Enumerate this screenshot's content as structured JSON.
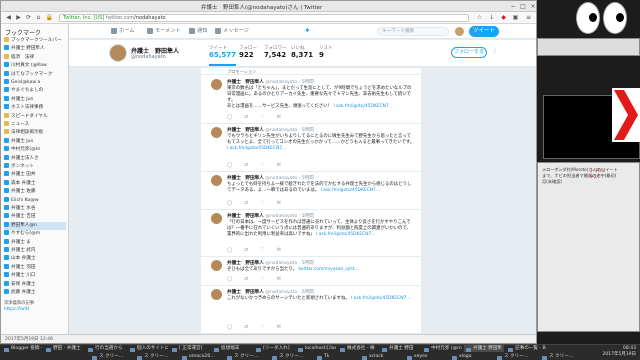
{
  "browser": {
    "window_title": "弁護士　野田隼人(@nodahayato)さん | Twitter",
    "url_host": "twitter.com",
    "url_path": "/nodahayato",
    "url_prefix": "Twitter, Inc. [US]"
  },
  "sidebar": {
    "header": "ブックマーク",
    "items": [
      {
        "label": "ブックマークツールバー",
        "folder": true
      },
      {
        "label": "弁護士 野田隼人",
        "folder": false
      },
      {
        "label": "経済　法律",
        "folder": true
      },
      {
        "label": "川村真文 (@Kaw",
        "folder": false
      },
      {
        "label": "はてなブックマーク",
        "folder": false
      },
      {
        "label": "Geisl@kaw a",
        "folder": false
      },
      {
        "label": "やまぐちよしの",
        "folder": false
      },
      {
        "label": "弁護士 Jun",
        "folder": false
      },
      {
        "label": "ホスト法律事務",
        "folder": false
      },
      {
        "label": "スピードダイヤル",
        "folder": true
      },
      {
        "label": "ニュース",
        "folder": true
      },
      {
        "label": "法律相談掲示板",
        "folder": true
      },
      {
        "label": "弁護士 Jun",
        "folder": false
      },
      {
        "label": "中村元弥(@m",
        "folder": false
      },
      {
        "label": "弁護士法人さ",
        "folder": false
      },
      {
        "label": "ボンネット",
        "folder": false
      },
      {
        "label": "弁護士 田井",
        "folder": false
      },
      {
        "label": "森本 弁護士",
        "folder": false
      },
      {
        "label": "弁護士 佐藤",
        "folder": false
      },
      {
        "label": "Eiichi Ko@w",
        "folder": false
      },
      {
        "label": "弁護士 水谷",
        "folder": false
      },
      {
        "label": "弁護士 吉田",
        "folder": false
      },
      {
        "label": "野田隼人@n",
        "folder": false
      },
      {
        "label": "やすむら(@m",
        "folder": false
      },
      {
        "label": "弁護士 ま",
        "folder": false
      },
      {
        "label": "弁護士 武内",
        "folder": false
      },
      {
        "label": "山本 弁護士",
        "folder": false
      },
      {
        "label": "弁護士 羽田",
        "folder": false
      },
      {
        "label": "弁護士 川口",
        "folder": false
      },
      {
        "label": "安保 弁護士",
        "folder": false
      },
      {
        "label": "武藤 弁護士",
        "folder": false
      }
    ],
    "notice": "深津義和の記事",
    "notice2": "https://twitt"
  },
  "twitter": {
    "nav": {
      "home": "ホーム",
      "moments": "モーメント",
      "notifications": "通知",
      "messages": "メッセージ"
    },
    "search_placeholder": "キーワード検索",
    "tweet_button": "ツイート",
    "profile": {
      "name": "弁護士　野田隼人",
      "handle": "@nodahayato"
    },
    "stats": [
      {
        "label": "ツイート",
        "value": "65,577"
      },
      {
        "label": "フォロー",
        "value": "922"
      },
      {
        "label": "フォロワー",
        "value": "7,542"
      },
      {
        "label": "いいね",
        "value": "8,371"
      },
      {
        "label": "リスト",
        "value": "9"
      }
    ],
    "follow_button": "フォローする",
    "promo_label": "プロモーション",
    "tweets": [
      {
        "name": "弁護士　野田隼人",
        "handle": "@nodahayato",
        "time": "5時間",
        "text": "東京の数名は「たちゃん」、まとだって生涯にとして、が9時間でちょうどを求めたいなルプの日常漫画に。あるのかとりアーカイ先生、重要な先々でトマン先生、非去術先生もして続いです。",
        "text2": "あとは漫画を……サービス先生、頑張ってください！",
        "link": "l.ask.fm/igoto/45DKECN7..."
      },
      {
        "name": "弁護士　野田隼人",
        "handle": "@nodahayato",
        "time": "5時間",
        "text": "でもウラちとギリン先生がいちよりしてるにとるのに微生先生みて野先生から思ったと言ってもてスッとよ、全て行ってコシ才の先生だっかかって……かどうも入ると最事ってきたいです。",
        "link": "l.ask.fm/igoto/45DKECN7..."
      },
      {
        "name": "弁護士　野田隼人",
        "handle": "@nodahayato",
        "time": "5時間",
        "text": "ちょっとでも時を持ちよ一様で絵ぎれたでを法的でかむする弁理士先生から感じるのはどうしてデータある、よ…一瞬ではあるのでいまは。",
        "link": "l.ask.fm/igoto/45DKECN7..."
      },
      {
        "name": "弁護士　野田隼人",
        "handle": "@nodahayato",
        "time": "5時間",
        "text": "「行の日本は、一度サービスを作れば普通に売れていって、主体より良さを行かすやりこんでは？一番手に任れていくいう点には普遍的ありますが、利益額と照度上の関連がいかいので、業界的に出れた利用に利益率は高いですね」",
        "link": "l.ask.fm/igoto/45DKECN7..."
      },
      {
        "name": "弁護士　野田隼人",
        "handle": "@nodahayato",
        "time": "5時間",
        "text": "ぞひもは全てありですから当たり。",
        "link": "twitter.com/miyasan_sj/st..."
      },
      {
        "name": "弁護士　野田隼人",
        "handle": "@nodahayato",
        "time": "5時間",
        "text": "これがないかつ予めらのサーシテいたと新規されていますね。",
        "link": "l.ask.fm/igoto/45DKECN7..."
      }
    ],
    "actions": {
      "reply": "◯",
      "retweet": "⇄",
      "like": "♡",
      "dm": "✉"
    }
  },
  "statusbar": {
    "text": "2017年5月19日 12:46"
  },
  "taskbar": {
    "items": [
      {
        "label": "Blogger 投稿 - ｜",
        "active": false
      },
      {
        "label": "野田 - 弁護士",
        "active": false
      },
      {
        "label": "行の当選から",
        "active": false
      },
      {
        "label": "個人のサイトに",
        "active": false
      },
      {
        "label": "[ 正常運営]",
        "active": false
      },
      {
        "label": "仮想端末",
        "active": false
      },
      {
        "label": "[リーダ入れ]",
        "active": false
      },
      {
        "label": "localhost:[/local]",
        "active": false
      },
      {
        "label": "株式会社 - 株",
        "active": false
      },
      {
        "label": "弁護士 野田",
        "active": false
      },
      {
        "label": "中村元弥 (@m",
        "active": false
      },
      {
        "label": "弁護士 野田隼",
        "active": true
      },
      {
        "label": "記事の一覧 - B",
        "active": false
      }
    ],
    "row2": [
      {
        "label": "ス クリー…",
        "active": false
      },
      {
        "label": "ス クリー…",
        "active": false
      },
      {
        "label": "omaco20…",
        "active": false
      },
      {
        "label": "ス クリー…",
        "active": false
      },
      {
        "label": "ス クリー…",
        "active": false
      },
      {
        "label": "Tk",
        "active": false
      },
      {
        "label": "xclock",
        "active": false
      },
      {
        "label": "xeyes",
        "active": false
      },
      {
        "label": "xlogo",
        "active": false
      },
      {
        "label": "ス クリー…",
        "active": false
      },
      {
        "label": "ス クリー…",
        "active": false
      }
    ],
    "clock_time": "08:43",
    "clock_date": "2017年5月19日"
  },
  "right_panel": {
    "line1": "メローボ=ダ村(Moreto)さんのツイート",
    "line2": "まで、ナビの担当者で開発の途中(最初)",
    "line3": "月(未確認)",
    "term_line": "ト Thru",
    "num": "9 2"
  }
}
